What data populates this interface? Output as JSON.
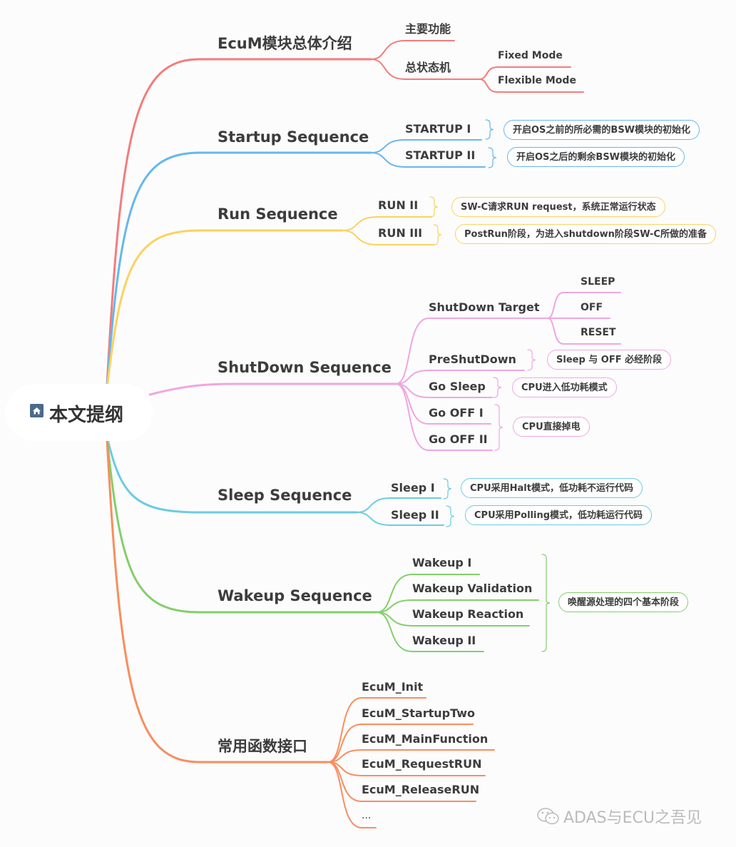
{
  "root": {
    "label": "本文提纲",
    "icon": "home-icon"
  },
  "colors": {
    "red": "#f47c7c",
    "blue": "#67b7ec",
    "yellow": "#fcd25d",
    "pink": "#f0a6e0",
    "cyan": "#6ccbe3",
    "green": "#83cf6a",
    "orange": "#f98d5c"
  },
  "branches": [
    {
      "label": "EcuM模块总体介绍",
      "children": [
        {
          "label": "主要功能"
        },
        {
          "label": "总状态机",
          "children": [
            {
              "label": "Fixed Mode"
            },
            {
              "label": "Flexible Mode"
            }
          ]
        }
      ]
    },
    {
      "label": "Startup Sequence",
      "children": [
        {
          "label": "STARTUP I",
          "note": "开启OS之前的所必需的BSW模块的初始化"
        },
        {
          "label": "STARTUP II",
          "note": "开启OS之后的剩余BSW模块的初始化"
        }
      ]
    },
    {
      "label": "Run Sequence",
      "children": [
        {
          "label": "RUN II",
          "note": "SW-C请求RUN request，系统正常运行状态"
        },
        {
          "label": "RUN III",
          "note": "PostRun阶段，为进入shutdown阶段SW-C所做的准备"
        }
      ]
    },
    {
      "label": "ShutDown Sequence",
      "children": [
        {
          "label": "ShutDown Target",
          "children": [
            {
              "label": "SLEEP"
            },
            {
              "label": "OFF"
            },
            {
              "label": "RESET"
            }
          ]
        },
        {
          "label": "PreShutDown",
          "note": "Sleep 与 OFF 必经阶段"
        },
        {
          "label": "Go Sleep",
          "note": "CPU进入低功耗模式"
        },
        {
          "label": "Go OFF I"
        },
        {
          "label": "Go OFF II"
        }
      ],
      "group_note": "CPU直接掉电"
    },
    {
      "label": "Sleep Sequence",
      "children": [
        {
          "label": "Sleep I",
          "note": "CPU采用Halt模式，低功耗不运行代码"
        },
        {
          "label": "Sleep II",
          "note": "CPU采用Polling模式，低功耗运行代码"
        }
      ]
    },
    {
      "label": "Wakeup Sequence",
      "children": [
        {
          "label": "Wakeup I"
        },
        {
          "label": "Wakeup Validation"
        },
        {
          "label": "Wakeup Reaction"
        },
        {
          "label": "Wakeup II"
        }
      ],
      "group_note": "唤醒源处理的四个基本阶段"
    },
    {
      "label": "常用函数接口",
      "children": [
        {
          "label": "EcuM_Init"
        },
        {
          "label": "EcuM_StartupTwo"
        },
        {
          "label": "EcuM_MainFunction"
        },
        {
          "label": "EcuM_RequestRUN"
        },
        {
          "label": "EcuM_ReleaseRUN"
        },
        {
          "label": "..."
        }
      ]
    }
  ],
  "watermark": {
    "icon": "wechat-icon",
    "text": "ADAS与ECU之吾见"
  }
}
